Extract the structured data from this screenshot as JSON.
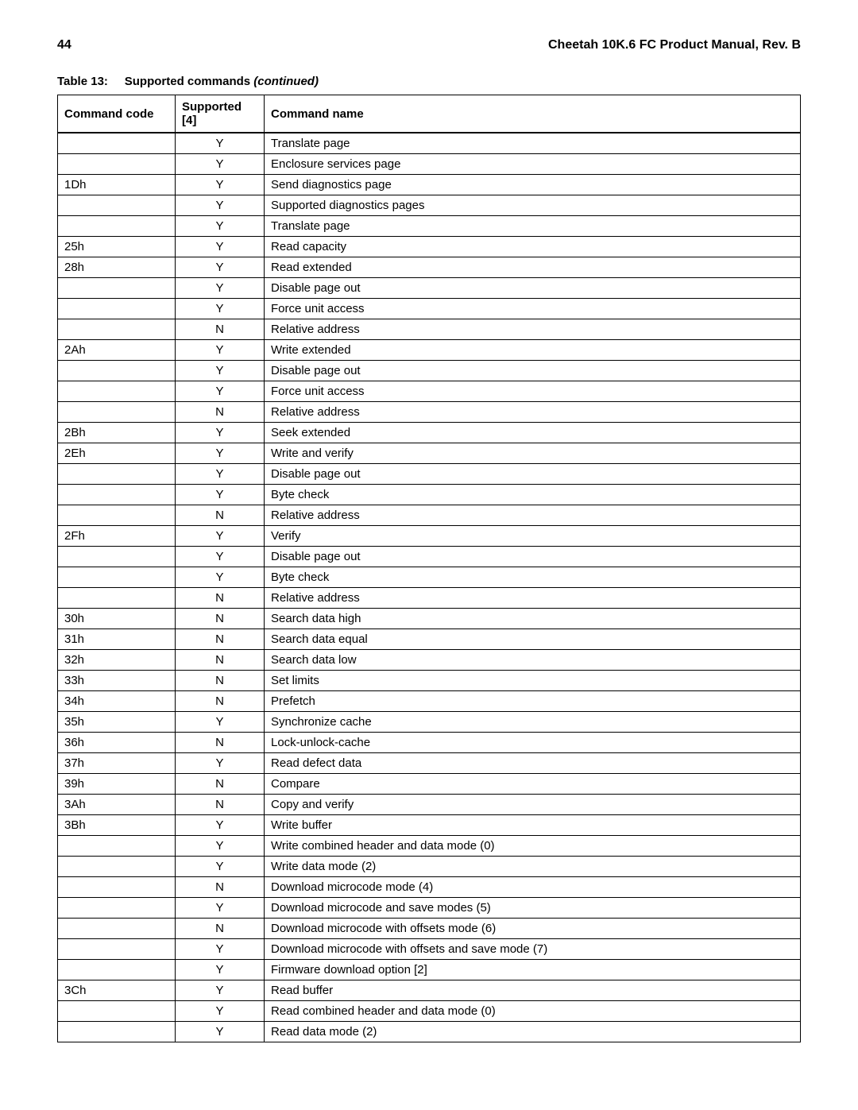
{
  "header": {
    "page_number": "44",
    "doc_title": "Cheetah 10K.6 FC Product Manual, Rev. B"
  },
  "caption": {
    "label": "Table 13:",
    "title": "Supported commands",
    "suffix": "(continued)"
  },
  "columns": {
    "code": "Command code",
    "supported": "Supported [4]",
    "name": "Command name"
  },
  "rows": [
    {
      "code": "",
      "supported": "Y",
      "name": "Translate page"
    },
    {
      "code": "",
      "supported": "Y",
      "name": "Enclosure services page"
    },
    {
      "code": "1Dh",
      "supported": "Y",
      "name": "Send diagnostics page"
    },
    {
      "code": "",
      "supported": "Y",
      "name": "Supported diagnostics pages"
    },
    {
      "code": "",
      "supported": "Y",
      "name": "Translate page"
    },
    {
      "code": "25h",
      "supported": "Y",
      "name": "Read capacity"
    },
    {
      "code": "28h",
      "supported": "Y",
      "name": "Read extended"
    },
    {
      "code": "",
      "supported": "Y",
      "name": "Disable page out"
    },
    {
      "code": "",
      "supported": "Y",
      "name": "Force unit access"
    },
    {
      "code": "",
      "supported": "N",
      "name": "Relative address"
    },
    {
      "code": "2Ah",
      "supported": "Y",
      "name": "Write extended"
    },
    {
      "code": "",
      "supported": "Y",
      "name": "Disable page out"
    },
    {
      "code": "",
      "supported": "Y",
      "name": "Force unit access"
    },
    {
      "code": "",
      "supported": "N",
      "name": "Relative address"
    },
    {
      "code": "2Bh",
      "supported": "Y",
      "name": "Seek extended"
    },
    {
      "code": "2Eh",
      "supported": "Y",
      "name": "Write and verify"
    },
    {
      "code": "",
      "supported": "Y",
      "name": "Disable page out"
    },
    {
      "code": "",
      "supported": "Y",
      "name": "Byte check"
    },
    {
      "code": "",
      "supported": "N",
      "name": "Relative address"
    },
    {
      "code": "2Fh",
      "supported": "Y",
      "name": "Verify"
    },
    {
      "code": "",
      "supported": "Y",
      "name": "Disable page out"
    },
    {
      "code": "",
      "supported": "Y",
      "name": "Byte check"
    },
    {
      "code": "",
      "supported": "N",
      "name": "Relative address"
    },
    {
      "code": "30h",
      "supported": "N",
      "name": "Search data high"
    },
    {
      "code": "31h",
      "supported": "N",
      "name": "Search data equal"
    },
    {
      "code": "32h",
      "supported": "N",
      "name": "Search data low"
    },
    {
      "code": "33h",
      "supported": "N",
      "name": "Set limits"
    },
    {
      "code": "34h",
      "supported": "N",
      "name": "Prefetch"
    },
    {
      "code": "35h",
      "supported": "Y",
      "name": "Synchronize cache"
    },
    {
      "code": "36h",
      "supported": "N",
      "name": "Lock-unlock-cache"
    },
    {
      "code": "37h",
      "supported": "Y",
      "name": "Read defect data"
    },
    {
      "code": "39h",
      "supported": "N",
      "name": "Compare"
    },
    {
      "code": "3Ah",
      "supported": "N",
      "name": "Copy and verify"
    },
    {
      "code": "3Bh",
      "supported": "Y",
      "name": "Write buffer"
    },
    {
      "code": "",
      "supported": "Y",
      "name": "Write combined header and data mode (0)"
    },
    {
      "code": "",
      "supported": "Y",
      "name": "Write data mode (2)"
    },
    {
      "code": "",
      "supported": "N",
      "name": "Download microcode mode (4)"
    },
    {
      "code": "",
      "supported": "Y",
      "name": "Download microcode and save modes (5)"
    },
    {
      "code": "",
      "supported": "N",
      "name": "Download microcode with offsets mode (6)"
    },
    {
      "code": "",
      "supported": "Y",
      "name": "Download microcode with offsets and save mode (7)"
    },
    {
      "code": "",
      "supported": "Y",
      "name": "Firmware download option [2]"
    },
    {
      "code": "3Ch",
      "supported": "Y",
      "name": "Read buffer"
    },
    {
      "code": "",
      "supported": "Y",
      "name": "Read combined header and data mode (0)"
    },
    {
      "code": "",
      "supported": "Y",
      "name": "Read data mode (2)"
    }
  ]
}
